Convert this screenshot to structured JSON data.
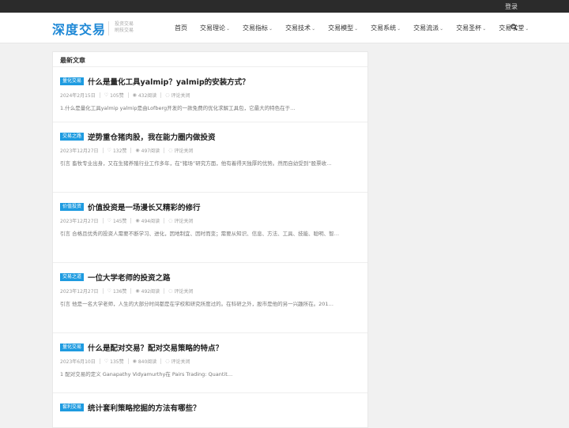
{
  "topbar": {
    "login": "登录"
  },
  "header": {
    "logo": "深度交易",
    "tagline": [
      "投资交易",
      "刷技交易"
    ]
  },
  "nav": {
    "items": [
      {
        "label": "首页",
        "dropdown": false
      },
      {
        "label": "交易理论",
        "dropdown": true
      },
      {
        "label": "交易指标",
        "dropdown": true
      },
      {
        "label": "交易技术",
        "dropdown": true
      },
      {
        "label": "交易模型",
        "dropdown": true
      },
      {
        "label": "交易系统",
        "dropdown": true
      },
      {
        "label": "交易流派",
        "dropdown": true
      },
      {
        "label": "交易圣杯",
        "dropdown": true
      },
      {
        "label": "交易学堂",
        "dropdown": true
      }
    ],
    "caret": "⌄"
  },
  "main": {
    "section_title": "最新文章",
    "posts": [
      {
        "category": "量化交易",
        "title": "什么是量化工具yalmip？yalmip的安装方式？",
        "date": "2024年2月15日",
        "likes": "105赞",
        "views": "432阅读",
        "comments": "评论关闭",
        "excerpt": "1.什么是量化工具yalmip yalmip是由Lofberg开发的一款免费的优化求解工具包，它最大的特色在于…"
      },
      {
        "category": "交易之路",
        "title": "逆势重仓猪肉股，我在能力圈内做投资",
        "date": "2023年12月27日",
        "likes": "132赞",
        "views": "497阅读",
        "comments": "评论关闭",
        "excerpt": "引言  畜牧专业出身，又在生猪养殖行业工作多年，在“猪场”研究方面，他有着得天独厚的优势。然而自幼受到“股票收…"
      },
      {
        "category": "价值投资",
        "title": "价值投资是一场漫长又精彩的修行",
        "date": "2023年12月27日",
        "likes": "145赞",
        "views": "494阅读",
        "comments": "评论关闭",
        "excerpt": "引言  合格且优秀的投资人需要不断学习、进化，因地制宜、因时而变；需要从知识、信息、方法、工具、技能、聪明、智…"
      },
      {
        "category": "交易之道",
        "title": "一位大学老师的投资之路",
        "date": "2023年12月27日",
        "likes": "136赞",
        "views": "492阅读",
        "comments": "评论关闭",
        "excerpt": "引言  他是一名大学老师，人生的大部分时间都是在学校和研究所度过的。在科研之外，股市是他的另一兴趣所在。201…"
      },
      {
        "category": "量化交易",
        "title": "什么是配对交易？配对交易策略的特点？",
        "date": "2023年6月10日",
        "likes": "135赞",
        "views": "840阅读",
        "comments": "评论关闭",
        "excerpt": "1    配对交易的定义 Ganapathy Vidyamurthy在 Pairs Trading: Quantit…"
      },
      {
        "category": "套利交易",
        "title": "统计套利策略挖掘的方法有哪些？",
        "date": "",
        "likes": "",
        "views": "",
        "comments": "",
        "excerpt": ""
      }
    ]
  },
  "icons": {
    "like": "thumbs-up-icon",
    "view": "eye-icon",
    "comment": "comment-icon",
    "search": "search-icon"
  },
  "colors": {
    "accent": "#1e9be0",
    "logo": "#1e88d6",
    "topbar": "#2b2b2b"
  }
}
